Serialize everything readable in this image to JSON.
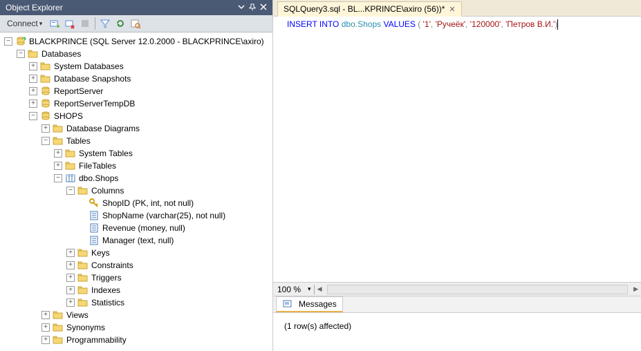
{
  "object_explorer": {
    "title": "Object Explorer",
    "connect_label": "Connect",
    "server": "BLACKPRINCE (SQL Server 12.0.2000 - BLACKPRINCE\\axiro)",
    "nodes": {
      "databases": "Databases",
      "system_databases": "System Databases",
      "database_snapshots": "Database Snapshots",
      "reportserver": "ReportServer",
      "reportservertempdb": "ReportServerTempDB",
      "shops": "SHOPS",
      "database_diagrams": "Database Diagrams",
      "tables": "Tables",
      "system_tables": "System Tables",
      "filetables": "FileTables",
      "dbo_shops": "dbo.Shops",
      "columns": "Columns",
      "col_shopid": "ShopID (PK, int, not null)",
      "col_shopname": "ShopName (varchar(25), not null)",
      "col_revenue": "Revenue (money, null)",
      "col_manager": "Manager (text, null)",
      "keys": "Keys",
      "constraints": "Constraints",
      "triggers": "Triggers",
      "indexes": "Indexes",
      "statistics": "Statistics",
      "views": "Views",
      "synonyms": "Synonyms",
      "programmability": "Programmability"
    }
  },
  "editor_tab": {
    "label": "SQLQuery3.sql - BL...KPRINCE\\axiro (56))*"
  },
  "sql": {
    "kw_insert": "INSERT",
    "kw_into": "INTO",
    "obj_dbo": "dbo",
    "obj_shops": "Shops",
    "kw_values": "VALUES",
    "v1": "'1'",
    "v2": "'Ручеёк'",
    "v3": "'120000'",
    "v4": "'Петров В.И.'"
  },
  "zoom": {
    "value": "100 %"
  },
  "messages": {
    "tab_label": "Messages",
    "body": "(1 row(s) affected)"
  }
}
